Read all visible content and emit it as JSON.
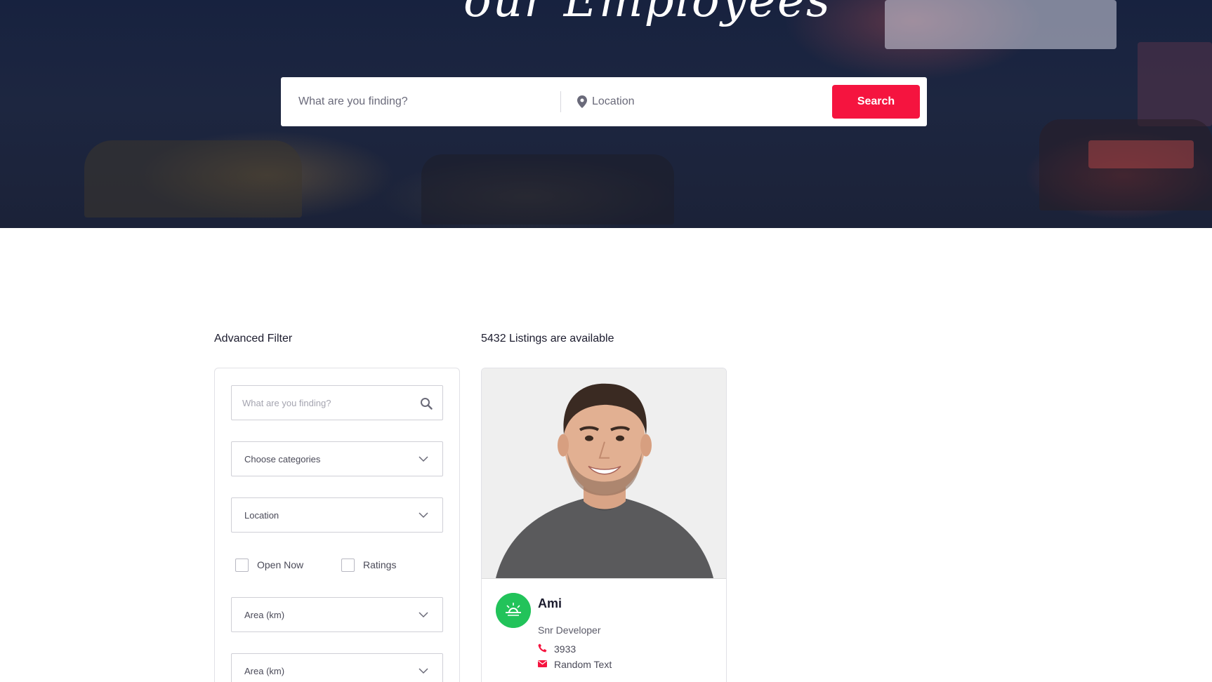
{
  "hero": {
    "title": "our Employees",
    "search_placeholder": "What are you finding?",
    "location_placeholder": "Location",
    "search_button": "Search"
  },
  "filter": {
    "heading": "Advanced Filter",
    "search_placeholder": "What are you finding?",
    "categories_select": "Choose categories",
    "location_select": "Location",
    "checkboxes": [
      {
        "label": "Open Now",
        "checked": false
      },
      {
        "label": "Ratings",
        "checked": false
      }
    ],
    "area_select_1": "Area (km)",
    "area_select_2": "Area (km)"
  },
  "listings": {
    "heading": "5432 Listings are available",
    "cards": [
      {
        "name": "Ami",
        "role": "Snr Developer",
        "phone": "3933",
        "email": "Random Text",
        "logo_color": "#22c35a"
      }
    ]
  },
  "colors": {
    "accent": "#f5143f",
    "hero_bg": "#1b2238",
    "logo_green": "#22c35a"
  },
  "icons": [
    "map-pin-icon",
    "search-icon",
    "chevron-down-icon",
    "phone-icon",
    "envelope-icon",
    "company-logo-icon"
  ]
}
